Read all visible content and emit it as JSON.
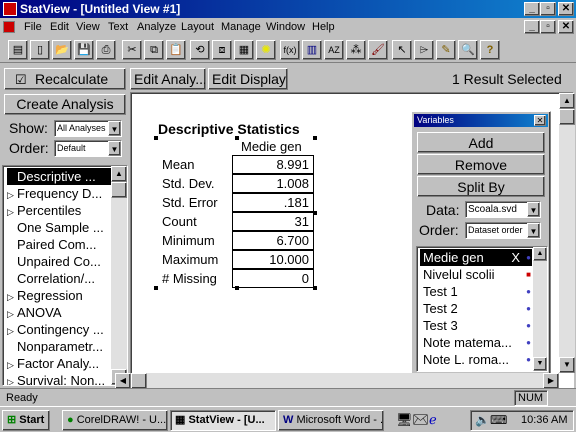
{
  "window": {
    "title": "StatView - [Untitled View #1]"
  },
  "menu": [
    "File",
    "Edit",
    "View",
    "Text",
    "Analyze",
    "Layout",
    "Manage",
    "Window",
    "Help"
  ],
  "toolbar": {
    "icons": [
      "new-doc",
      "new-page",
      "open",
      "save",
      "print",
      "cut",
      "copy",
      "paste",
      "rotate",
      "group",
      "ungroup",
      "highlight",
      "fx",
      "table",
      "sort-az",
      "chart",
      "brush",
      "arrow",
      "pointer",
      "pencil",
      "magnify",
      "help"
    ],
    "fx_label": "f(x)",
    "az_label": "AZ"
  },
  "second_bar": {
    "recalculate_label": "Recalculate",
    "edit_analysis_label": "Edit Analy...",
    "edit_display_label": "Edit Display",
    "result_status": "1 Result Selected"
  },
  "left_panel": {
    "create_button": "Create Analysis",
    "show_label": "Show:",
    "show_value": "All Analyses",
    "order_label": "Order:",
    "order_value": "Default",
    "items": [
      {
        "label": "Descriptive ...",
        "selected": true,
        "expandable": false
      },
      {
        "label": "Frequency D...",
        "selected": false,
        "expandable": true
      },
      {
        "label": "Percentiles",
        "selected": false,
        "expandable": true
      },
      {
        "label": "One Sample ...",
        "selected": false,
        "expandable": false
      },
      {
        "label": "Paired Com...",
        "selected": false,
        "expandable": false
      },
      {
        "label": "Unpaired Co...",
        "selected": false,
        "expandable": false
      },
      {
        "label": "Correlation/...",
        "selected": false,
        "expandable": false
      },
      {
        "label": "Regression",
        "selected": false,
        "expandable": true
      },
      {
        "label": "ANOVA",
        "selected": false,
        "expandable": true
      },
      {
        "label": "Contingency ...",
        "selected": false,
        "expandable": true
      },
      {
        "label": "Nonparametr...",
        "selected": false,
        "expandable": false
      },
      {
        "label": "Factor Analy...",
        "selected": false,
        "expandable": true
      },
      {
        "label": "Survival: Non...",
        "selected": false,
        "expandable": true
      }
    ]
  },
  "descriptive": {
    "title": "Descriptive Statistics",
    "column": "Medie gen",
    "rows": [
      {
        "label": "Mean",
        "value": "8.991"
      },
      {
        "label": "Std. Dev.",
        "value": "1.008"
      },
      {
        "label": "Std. Error",
        "value": ".181"
      },
      {
        "label": "Count",
        "value": "31"
      },
      {
        "label": "Minimum",
        "value": "6.700"
      },
      {
        "label": "Maximum",
        "value": "10.000"
      },
      {
        "label": "# Missing",
        "value": "0"
      }
    ]
  },
  "variables": {
    "title": "Variables",
    "add": "Add",
    "remove": "Remove",
    "split_by": "Split By",
    "data_label": "Data:",
    "data_value": "Scoala.svd",
    "order_label": "Order:",
    "order_value": "Dataset order",
    "items": [
      {
        "label": "Medie gen",
        "selected": true,
        "marker": "X"
      },
      {
        "label": "Nivelul scolii",
        "selected": false
      },
      {
        "label": "Test 1",
        "selected": false
      },
      {
        "label": "Test 2",
        "selected": false
      },
      {
        "label": "Test 3",
        "selected": false
      },
      {
        "label": "Note matema...",
        "selected": false
      },
      {
        "label": "Note L. roma...",
        "selected": false
      }
    ]
  },
  "status": {
    "left": "Ready",
    "num": "NUM"
  },
  "taskbar": {
    "start": "Start",
    "tasks": [
      "CorelDRAW! - U...",
      "StatView - [U...",
      "Microsoft Word - ..."
    ],
    "active_task": 1,
    "clock": "10:36 AM"
  }
}
